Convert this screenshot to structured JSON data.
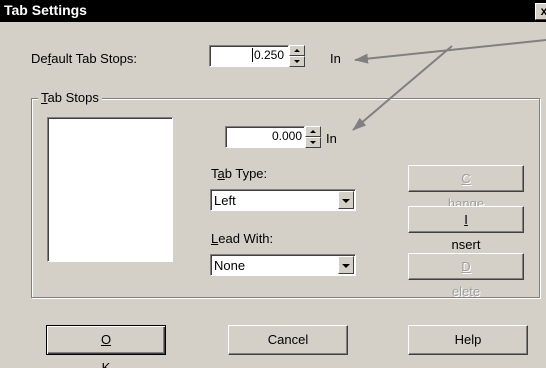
{
  "dialog": {
    "title": "Tab Settings",
    "close_label": "x"
  },
  "default_tab_stops": {
    "label_pre": "De",
    "label_mnemonic": "f",
    "label_post": "ault Tab Stops:",
    "value": "0.250",
    "unit": "In"
  },
  "tab_stops_group": {
    "label_mnemonic": "T",
    "label_post": "ab Stops",
    "position_value": "0.000",
    "position_unit": "In",
    "tab_type_label_pre": "T",
    "tab_type_mnemonic": "a",
    "tab_type_label_post": "b Type:",
    "tab_type_value": "Left",
    "lead_with_mnemonic": "L",
    "lead_with_label_post": "ead With:",
    "lead_with_value": "None"
  },
  "side_buttons": {
    "change_mnemonic": "C",
    "change_post": "hange",
    "insert_mnemonic": "I",
    "insert_post": "nsert",
    "delete_mnemonic": "D",
    "delete_post": "elete"
  },
  "footer": {
    "ok_mnemonic": "O",
    "ok_post": "K",
    "cancel_label": "Cancel",
    "help_label": "Help"
  },
  "colors": {
    "dialog_bg": "#d4d0c8",
    "titlebar_bg": "#000000",
    "arrow": "#808080"
  }
}
